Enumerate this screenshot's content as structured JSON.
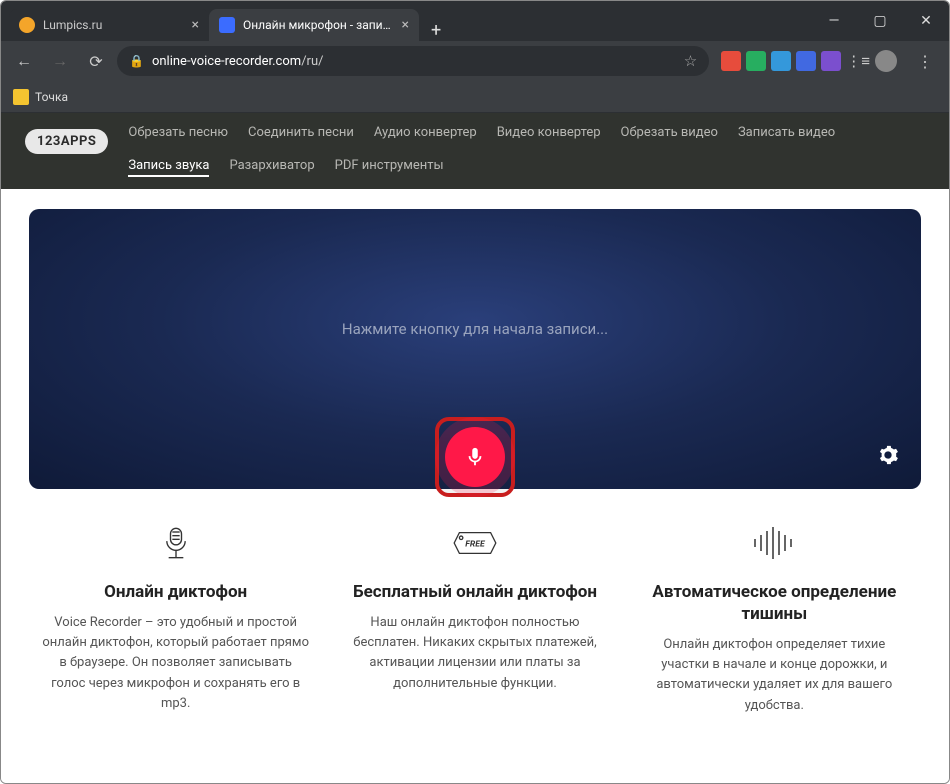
{
  "tabs": [
    {
      "title": "Lumpics.ru",
      "active": false
    },
    {
      "title": "Онлайн микрофон - запись гол",
      "active": true
    }
  ],
  "url": {
    "domain": "online-voice-recorder.com",
    "path": "/ru/"
  },
  "bookmarks": [
    {
      "label": "Точка"
    }
  ],
  "site": {
    "logo": "123APPS",
    "nav": [
      "Обрезать песню",
      "Соединить песни",
      "Аудио конвертер",
      "Видео конвертер",
      "Обрезать видео",
      "Записать видео",
      "Запись звука",
      "Разархиватор",
      "PDF инструменты"
    ],
    "nav_active_index": 6
  },
  "hero": {
    "prompt": "Нажмите кнопку для начала записи..."
  },
  "features": [
    {
      "title": "Онлайн диктофон",
      "desc": "Voice Recorder – это удобный и простой онлайн диктофон, который работает прямо в браузере. Он позволяет записывать голос через микрофон и сохранять его в mp3."
    },
    {
      "title": "Бесплатный онлайн диктофон",
      "desc": "Наш онлайн диктофон полностью бесплатен. Никаких скрытых платежей, активации лицензии или платы за дополнительные функции."
    },
    {
      "title": "Автоматическое определение тишины",
      "desc": "Онлайн диктофон определяет тихие участки в начале и конце дорожки, и автоматически удаляет их для вашего удобства."
    }
  ]
}
